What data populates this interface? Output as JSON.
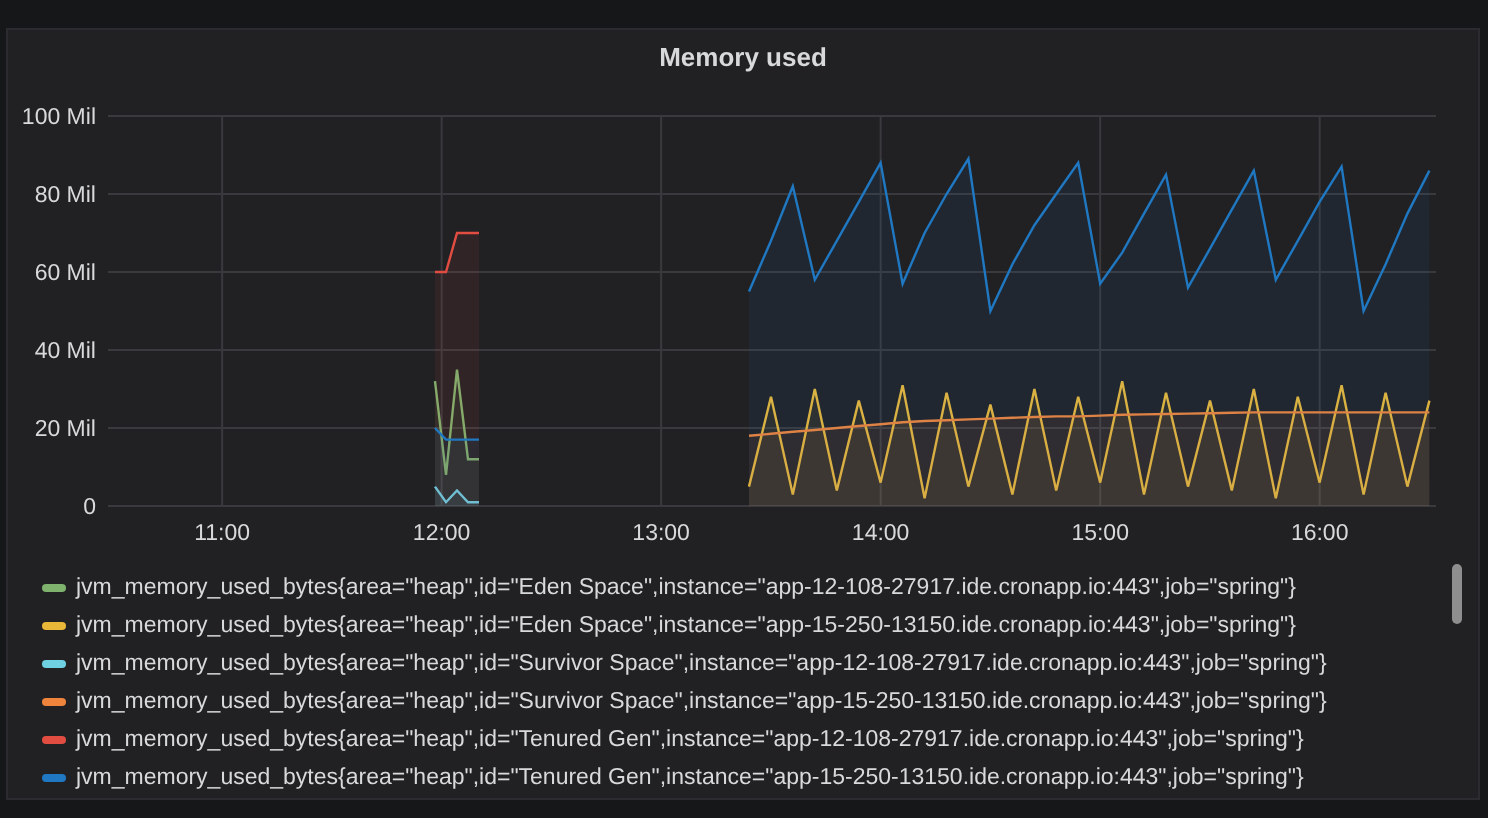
{
  "panel": {
    "title": "Memory used"
  },
  "chart_data": {
    "type": "area",
    "grid": true,
    "ylim": [
      0,
      100
    ],
    "xlim": [
      10.48,
      16.53
    ],
    "yticks": [
      {
        "value": 0,
        "label": "0"
      },
      {
        "value": 20,
        "label": "20 Mil"
      },
      {
        "value": 40,
        "label": "40 Mil"
      },
      {
        "value": 60,
        "label": "60 Mil"
      },
      {
        "value": 80,
        "label": "80 Mil"
      },
      {
        "value": 100,
        "label": "100 Mil"
      }
    ],
    "xticks": [
      {
        "value": 11,
        "label": "11:00"
      },
      {
        "value": 12,
        "label": "12:00"
      },
      {
        "value": 13,
        "label": "13:00"
      },
      {
        "value": 14,
        "label": "14:00"
      },
      {
        "value": 15,
        "label": "15:00"
      },
      {
        "value": 16,
        "label": "16:00"
      }
    ],
    "x": [
      11.97,
      12.02,
      12.07,
      12.12,
      12.17,
      13.4,
      13.5,
      13.6,
      13.7,
      13.8,
      13.9,
      14.0,
      14.1,
      14.2,
      14.3,
      14.4,
      14.5,
      14.6,
      14.7,
      14.8,
      14.9,
      15.0,
      15.1,
      15.2,
      15.3,
      15.4,
      15.5,
      15.6,
      15.7,
      15.8,
      15.9,
      16.0,
      16.1,
      16.2,
      16.3,
      16.4,
      16.5
    ],
    "series": [
      {
        "name": "jvm_memory_used_bytes{area=\"heap\",id=\"Eden Space\",instance=\"app-12-108-27917.ide.cronapp.io:443\",job=\"spring\"}",
        "color": "#7eb26d",
        "values": [
          32,
          8,
          35,
          12,
          12,
          null,
          null,
          null,
          null,
          null,
          null,
          null,
          null,
          null,
          null,
          null,
          null,
          null,
          null,
          null,
          null,
          null,
          null,
          null,
          null,
          null,
          null,
          null,
          null,
          null,
          null,
          null,
          null,
          null,
          null,
          null,
          null
        ]
      },
      {
        "name": "jvm_memory_used_bytes{area=\"heap\",id=\"Eden Space\",instance=\"app-15-250-13150.ide.cronapp.io:443\",job=\"spring\"}",
        "color": "#eab839",
        "values": [
          null,
          null,
          null,
          null,
          null,
          5,
          28,
          3,
          30,
          4,
          27,
          6,
          31,
          2,
          29,
          5,
          26,
          3,
          30,
          4,
          28,
          6,
          32,
          3,
          29,
          5,
          27,
          4,
          30,
          2,
          28,
          6,
          31,
          3,
          29,
          5,
          27
        ]
      },
      {
        "name": "jvm_memory_used_bytes{area=\"heap\",id=\"Survivor Space\",instance=\"app-12-108-27917.ide.cronapp.io:443\",job=\"spring\"}",
        "color": "#6ed0e0",
        "values": [
          5,
          1,
          4,
          1,
          1,
          null,
          null,
          null,
          null,
          null,
          null,
          null,
          null,
          null,
          null,
          null,
          null,
          null,
          null,
          null,
          null,
          null,
          null,
          null,
          null,
          null,
          null,
          null,
          null,
          null,
          null,
          null,
          null,
          null,
          null,
          null,
          null
        ]
      },
      {
        "name": "jvm_memory_used_bytes{area=\"heap\",id=\"Survivor Space\",instance=\"app-15-250-13150.ide.cronapp.io:443\",job=\"spring\"}",
        "color": "#ef843c",
        "values": [
          null,
          null,
          null,
          null,
          null,
          18,
          18.5,
          19,
          19.5,
          20,
          20.5,
          21,
          21.5,
          21.8,
          22,
          22.2,
          22.4,
          22.6,
          22.8,
          23,
          23,
          23.2,
          23.4,
          23.5,
          23.6,
          23.7,
          23.8,
          23.9,
          24,
          24,
          24,
          24,
          24,
          24,
          24,
          24,
          24
        ]
      },
      {
        "name": "jvm_memory_used_bytes{area=\"heap\",id=\"Tenured Gen\",instance=\"app-12-108-27917.ide.cronapp.io:443\",job=\"spring\"}",
        "color": "#e24d42",
        "values": [
          60,
          60,
          70,
          70,
          70,
          null,
          null,
          null,
          null,
          null,
          null,
          null,
          null,
          null,
          null,
          null,
          null,
          null,
          null,
          null,
          null,
          null,
          null,
          null,
          null,
          null,
          null,
          null,
          null,
          null,
          null,
          null,
          null,
          null,
          null,
          null,
          null
        ]
      },
      {
        "name": "jvm_memory_used_bytes{area=\"heap\",id=\"Tenured Gen\",instance=\"app-15-250-13150.ide.cronapp.io:443\",job=\"spring\"}",
        "color": "#1f78c1",
        "values": [
          20,
          17,
          17,
          17,
          17,
          55,
          68,
          82,
          58,
          68,
          78,
          88,
          57,
          70,
          80,
          89,
          50,
          62,
          72,
          80,
          88,
          57,
          65,
          75,
          85,
          56,
          66,
          76,
          86,
          58,
          68,
          78,
          87,
          50,
          62,
          75,
          86
        ]
      }
    ]
  }
}
